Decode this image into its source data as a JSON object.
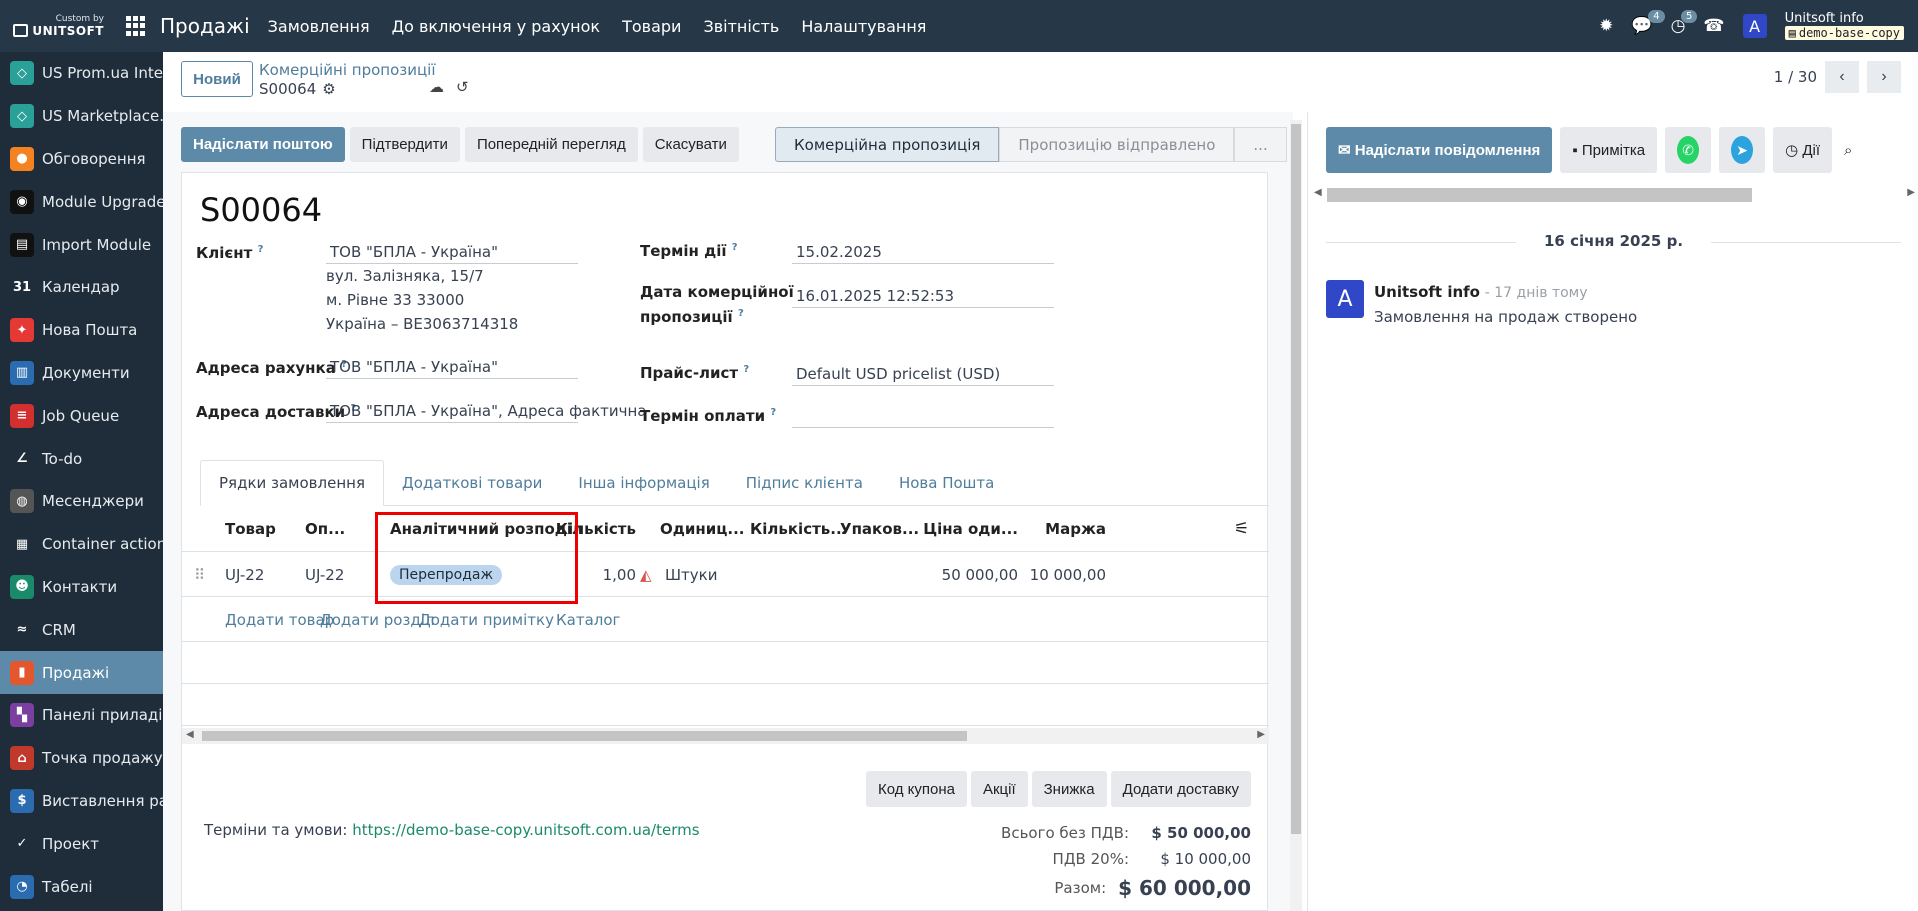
{
  "topbar": {
    "logo_top": "Custom by",
    "logo_bottom": "UNITSOFT",
    "brand": "Продажі",
    "menu": [
      "Замовлення",
      "До включення у рахунок",
      "Товари",
      "Звітність",
      "Налаштування"
    ],
    "chat_badge": "4",
    "activity_badge": "5",
    "avatar": "A",
    "user": "Unitsoft info",
    "db": "demo-base-copy"
  },
  "sidebar": [
    {
      "label": "US Prom.ua Inte...",
      "color": "#2aa198",
      "glyph": "◇"
    },
    {
      "label": "US Marketplace...",
      "color": "#2aa198",
      "glyph": "◇"
    },
    {
      "label": "Обговорення",
      "color": "#f58220",
      "glyph": "●"
    },
    {
      "label": "Module Upgrade",
      "color": "#111",
      "glyph": "◉"
    },
    {
      "label": "Import Module",
      "color": "#111",
      "glyph": "▤"
    },
    {
      "label": "Календар",
      "color": "#1f2d3a",
      "glyph": "31"
    },
    {
      "label": "Нова Пошта",
      "color": "#e53935",
      "glyph": "✦"
    },
    {
      "label": "Документи",
      "color": "#2b6cb0",
      "glyph": "▥"
    },
    {
      "label": "Job Queue",
      "color": "#d32f2f",
      "glyph": "≡"
    },
    {
      "label": "To-do",
      "color": "#1f2d3a",
      "glyph": "∠"
    },
    {
      "label": "Месенджери",
      "color": "#555",
      "glyph": "◍"
    },
    {
      "label": "Container actions",
      "color": "#1f2d3a",
      "glyph": "▦"
    },
    {
      "label": "Контакти",
      "color": "#1b8a6b",
      "glyph": "☻"
    },
    {
      "label": "CRM",
      "color": "#1f2d3a",
      "glyph": "≈"
    },
    {
      "label": "Продажі",
      "color": "#e4572e",
      "glyph": "▮",
      "active": true
    },
    {
      "label": "Панелі приладів",
      "color": "#7b3fa0",
      "glyph": "▚"
    },
    {
      "label": "Точка продажу",
      "color": "#c0392b",
      "glyph": "⌂"
    },
    {
      "label": "Виставлення ра...",
      "color": "#2b6cb0",
      "glyph": "$"
    },
    {
      "label": "Проект",
      "color": "#1f2d3a",
      "glyph": "✓"
    },
    {
      "label": "Табелі",
      "color": "#2b6cb0",
      "glyph": "◔"
    }
  ],
  "control": {
    "new_label": "Новий",
    "breadcrumb": "Комерційні пропозиції",
    "record": "S00064",
    "pager": "1 / 30"
  },
  "actions": [
    "Надіслати поштою",
    "Підтвердити",
    "Попередній перегляд",
    "Скасувати"
  ],
  "stages": [
    "Комерційна пропозиція",
    "Пропозицію відправлено",
    "..."
  ],
  "form": {
    "title": "S00064",
    "client_label": "Клієнт",
    "client": "ТОВ \"БПЛА - Україна\"",
    "addr1": "вул. Залізняка, 15/7",
    "addr2": "м. Рівне 33 33000",
    "addr3": "Україна – BE3063714318",
    "invoice_label": "Адреса рахунка",
    "invoice": "ТОВ \"БПЛА - Україна\"",
    "delivery_label": "Адреса доставки",
    "delivery": "ТОВ \"БПЛА - Україна\", Адреса фактична",
    "validity_label": "Термін дії",
    "validity": "15.02.2025",
    "date_label1": "Дата комерційної",
    "date_label2": "пропозиції",
    "date": "16.01.2025 12:52:53",
    "pricelist_label": "Прайс-лист",
    "pricelist": "Default USD pricelist (USD)",
    "payment_label": "Термін оплати",
    "q": "?"
  },
  "tabs": [
    "Рядки замовлення",
    "Додаткові товари",
    "Інша інформація",
    "Підпис клієнта",
    "Нова Пошта"
  ],
  "table": {
    "headers": [
      "Товар",
      "Оп...",
      "Аналітичний розподіл",
      "Кількість",
      "Одиниц...",
      "Кількість...",
      "Упаков...",
      "Ціна оди...",
      "Маржа"
    ],
    "row": {
      "product": "UJ-22",
      "desc": "UJ-22",
      "analytic": "Перепродаж",
      "qty": "1,00",
      "uom": "Штуки",
      "price": "50 000,00",
      "margin": "10 000,00"
    },
    "add": [
      "Додати товар",
      "Додати розділ",
      "Додати примітку",
      "Каталог"
    ]
  },
  "coupons": [
    "Код купона",
    "Акції",
    "Знижка",
    "Додати доставку"
  ],
  "terms": {
    "label": "Терміни та умови:",
    "link": "https://demo-base-copy.unitsoft.com.ua/terms"
  },
  "totals": {
    "untaxed_label": "Всього без ПДВ:",
    "untaxed": "$ 50 000,00",
    "tax_label": "ПДВ 20%:",
    "tax": "$ 10 000,00",
    "total_label": "Разом:",
    "total": "$ 60 000,00"
  },
  "chatter": {
    "send": "Надіслати повідомлення",
    "note": "Примітка",
    "actions": "Дії",
    "date": "16 січня 2025 р.",
    "author": "Unitsoft info",
    "ago": "- 17 днів тому",
    "body": "Замовлення на продаж створено",
    "avatar": "A"
  }
}
